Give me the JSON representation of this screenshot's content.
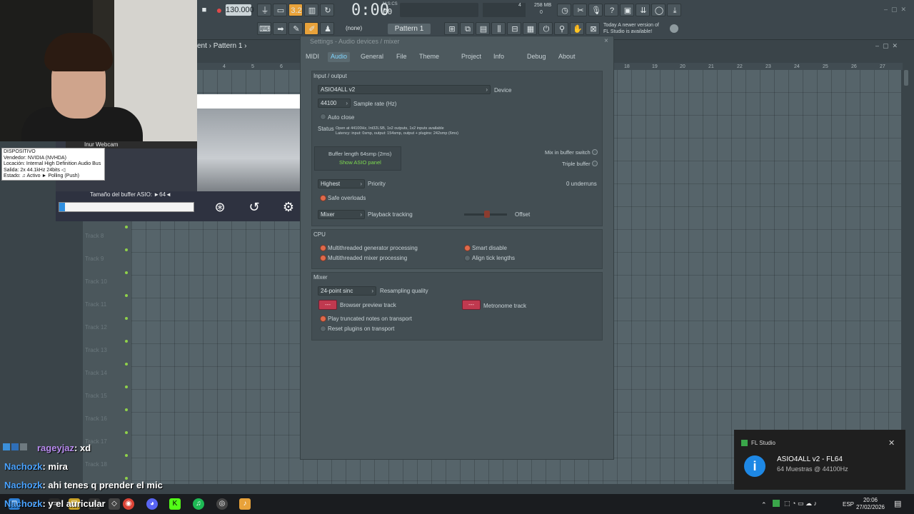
{
  "toolbar": {
    "tempo": "130.000",
    "time": "0:00",
    "time_sub": "00",
    "time_unit": "M:S:CS",
    "memory": "258 MB",
    "memory_sub": "0",
    "cpu_val": "4",
    "pattern": "Pattern 1",
    "channel_select": "(none)",
    "news_line1": "Today  A newer version of",
    "news_line2": "FL Studio is available!",
    "pattern_mode": "3.2"
  },
  "playlist": {
    "title_prefix": "ent",
    "title": "Pattern 1",
    "ruler": [
      "4",
      "5",
      "6",
      "18",
      "19",
      "20",
      "21",
      "22",
      "23",
      "24",
      "25",
      "26",
      "27"
    ],
    "tracks": [
      "Track 8",
      "Track 9",
      "Track 10",
      "Track 11",
      "Track 12",
      "Track 13",
      "Track 14",
      "Track 15",
      "Track 16",
      "Track 17",
      "Track 18"
    ]
  },
  "webcam": {
    "label": "Inur Webcam"
  },
  "asio_panel": {
    "buffer_label": "Tamaño del buffer ASIO: ►64◄",
    "close": "✕"
  },
  "tooltip": {
    "lines": [
      "DISPOSITIVO",
      "Vendedor: NVIDIA (NVHDA)",
      "Locación: Internal High Definition Audio Bus",
      "Salida: 2x 44.1kHz 24bits ◁",
      "Estado: ♫ Activo ► Polling (Push)"
    ]
  },
  "settings": {
    "title": "Settings - Audio devices / mixer",
    "close": "×",
    "tabs": [
      "MIDI",
      "Audio",
      "General",
      "File",
      "Theme",
      "Project",
      "Info",
      "Debug",
      "About"
    ],
    "active_tab": "Audio",
    "io": {
      "header": "Input / output",
      "device_value": "ASIO4ALL v2",
      "device_label": "Device",
      "sample_rate_value": "44100",
      "sample_rate_label": "Sample rate (Hz)",
      "auto_close": "Auto close",
      "status_label": "Status",
      "status_line1": "Open at 44100Hz, Int32LSB, 1x2 outputs, 1x2 inputs available",
      "status_line2": "Latency: input: 0smp, output: 154smp, output + plugins: 242smp (6ms)",
      "buffer_length": "Buffer length 64smp (2ms)",
      "show_asio": "Show ASIO panel",
      "mix_in_buffer": "Mix in buffer switch",
      "triple_buffer": "Triple buffer",
      "priority_value": "Highest",
      "priority_label": "Priority",
      "underruns": "0 underruns",
      "safe_overloads": "Safe overloads",
      "tracking_value": "Mixer",
      "tracking_label": "Playback tracking",
      "offset_label": "Offset"
    },
    "cpu": {
      "header": "CPU",
      "multi_gen": "Multithreaded generator processing",
      "multi_mix": "Multithreaded mixer processing",
      "smart_disable": "Smart disable",
      "align_tick": "Align tick lengths"
    },
    "mixer": {
      "header": "Mixer",
      "resampling_value": "24-point sinc",
      "resampling_label": "Resampling quality",
      "preview_btn": "---",
      "preview_label": "Browser preview track",
      "metronome_btn": "---",
      "metronome_label": "Metronome track",
      "play_truncated": "Play truncated notes on transport",
      "reset_plugins": "Reset plugins on transport"
    }
  },
  "chat": [
    {
      "user": "rageyjaz",
      "msg": ": xd"
    },
    {
      "user": "Nachozk",
      "msg": ": mira"
    },
    {
      "user": "Nachozk",
      "msg": ": ahi tenes q prender el mic"
    },
    {
      "user": "Nachozk",
      "msg": ": y el auricular"
    }
  ],
  "toast": {
    "app": "FL Studio",
    "icon": "i",
    "title": "ASIO4ALL v2 - FL64",
    "subtitle": "64 Muestras @ 44100Hz",
    "close": "✕"
  },
  "taskbar": {
    "lang": "ESP",
    "time": "20:06",
    "date": "27/02/2026"
  }
}
